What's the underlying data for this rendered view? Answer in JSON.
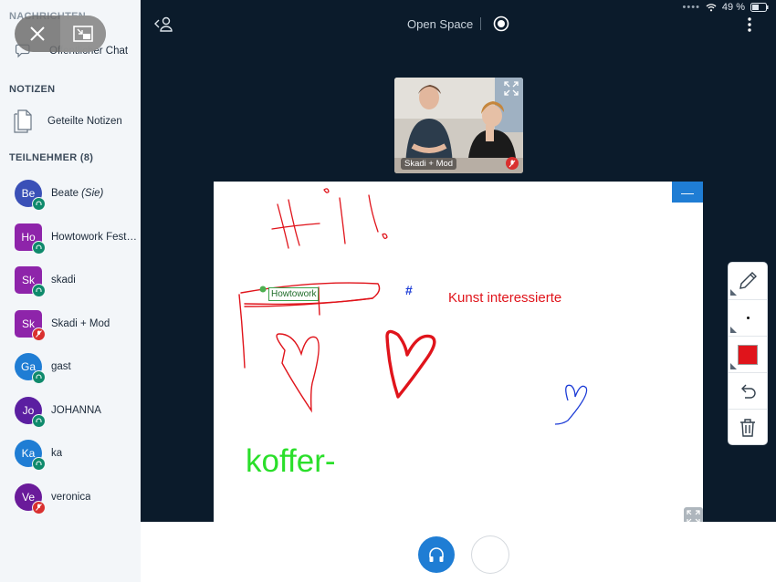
{
  "sidebar": {
    "messages_header": "NACHRICHTEN",
    "public_chat": "Öffentlicher Chat",
    "notes_header": "NOTIZEN",
    "shared_notes": "Geteilte Notizen",
    "participants_header": "TEILNEHMER (8)",
    "participants": [
      {
        "initials": "Be",
        "name": "Beate",
        "suffix": "(Sie)",
        "color": "#3a50b7",
        "shape": "round",
        "status": "listen"
      },
      {
        "initials": "Ho",
        "name": "Howtowork Festi...",
        "suffix": "",
        "color": "#8e24aa",
        "shape": "square",
        "status": "listen"
      },
      {
        "initials": "Sk",
        "name": "skadi",
        "suffix": "",
        "color": "#8e24aa",
        "shape": "square",
        "status": "listen"
      },
      {
        "initials": "Sk",
        "name": "Skadi + Mod",
        "suffix": "",
        "color": "#8e24aa",
        "shape": "square",
        "status": "mute"
      },
      {
        "initials": "Ga",
        "name": "gast",
        "suffix": "",
        "color": "#1f7dd4",
        "shape": "round",
        "status": "listen"
      },
      {
        "initials": "Jo",
        "name": "JOHANNA",
        "suffix": "",
        "color": "#5b1fa1",
        "shape": "round",
        "status": "listen"
      },
      {
        "initials": "Ka",
        "name": "ka",
        "suffix": "",
        "color": "#1f7dd4",
        "shape": "round",
        "status": "listen"
      },
      {
        "initials": "Ve",
        "name": "veronica",
        "suffix": "",
        "color": "#6a1b9a",
        "shape": "round",
        "status": "mute"
      }
    ]
  },
  "topbar": {
    "room_title": "Open Space",
    "battery": "49 %"
  },
  "video": {
    "name_label": "Skadi + Mod"
  },
  "whiteboard": {
    "note_label": "Howtowork",
    "hash_text": "#",
    "kunst_text": "Kunst interessierte",
    "koffer_text": "koffer-",
    "minimize_label": "—",
    "pen_color": "#e0141b"
  },
  "icons": {
    "close": "close-icon",
    "pip": "pip-icon",
    "chat": "chat-icon",
    "notes": "document-icon",
    "leave": "user-leave-icon",
    "record": "record-icon",
    "more": "more-vertical-icon",
    "pencil": "pencil-icon",
    "undo": "undo-icon",
    "trash": "trash-icon",
    "headphones": "headphones-icon",
    "fullscreen": "fullscreen-icon"
  }
}
